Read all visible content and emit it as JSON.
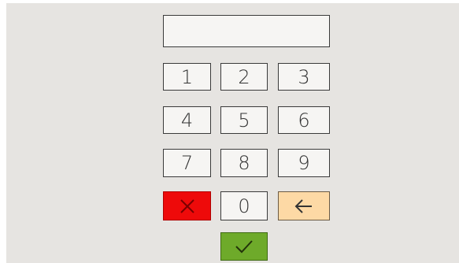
{
  "keypad": {
    "display_value": "",
    "keys": {
      "k1": "1",
      "k2": "2",
      "k3": "3",
      "k4": "4",
      "k5": "5",
      "k6": "6",
      "k7": "7",
      "k8": "8",
      "k9": "9",
      "k0": "0"
    },
    "icons": {
      "cancel": "close-icon",
      "backspace": "arrow-left-icon",
      "confirm": "checkmark-icon"
    },
    "colors": {
      "background": "#e6e4e1",
      "key": "#f6f5f3",
      "cancel": "#ee0a0a",
      "backspace": "#fdd9a5",
      "confirm": "#6eaa2a"
    }
  }
}
